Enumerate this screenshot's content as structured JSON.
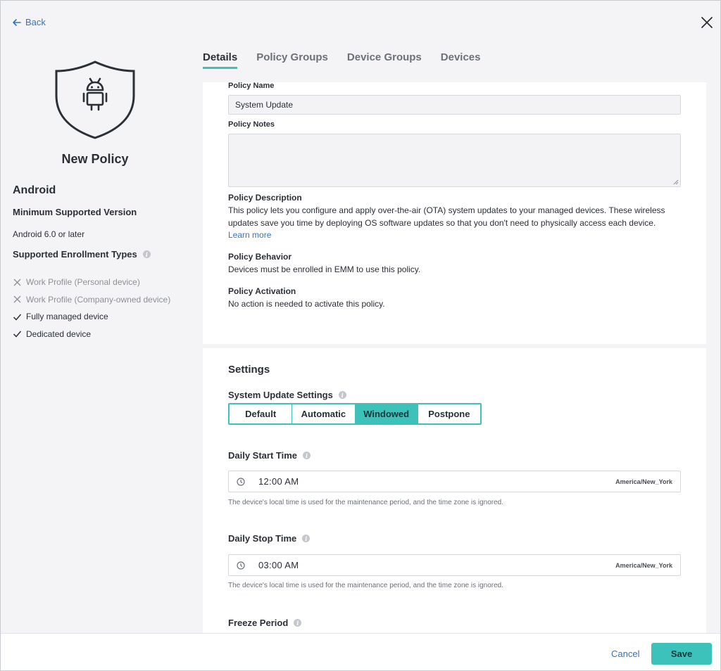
{
  "header": {
    "back_label": "Back"
  },
  "sidebar": {
    "policy_title": "New Policy",
    "os_title": "Android",
    "min_version_title": "Minimum Supported Version",
    "min_version_value": "Android 6.0 or later",
    "enrollment_title": "Supported Enrollment Types",
    "enrollment_types": [
      {
        "label": "Work Profile (Personal device)",
        "supported": false
      },
      {
        "label": "Work Profile (Company-owned device)",
        "supported": false
      },
      {
        "label": "Fully managed device",
        "supported": true
      },
      {
        "label": "Dedicated device",
        "supported": true
      }
    ]
  },
  "tabs": [
    {
      "label": "Details",
      "active": true
    },
    {
      "label": "Policy Groups",
      "active": false
    },
    {
      "label": "Device Groups",
      "active": false
    },
    {
      "label": "Devices",
      "active": false
    }
  ],
  "details": {
    "policy_name_label": "Policy Name",
    "policy_name_value": "System Update",
    "policy_notes_label": "Policy Notes",
    "policy_notes_value": "",
    "description_title": "Policy Description",
    "description_text": "This policy lets you configure and apply over-the-air (OTA) system updates to your managed devices. These wireless updates save you time by deploying OS software updates so that you don't need to physically access each device.",
    "learn_more": "Learn more",
    "behavior_title": "Policy Behavior",
    "behavior_text": "Devices must be enrolled in EMM to use this policy.",
    "activation_title": "Policy Activation",
    "activation_text": "No action is needed to activate this policy."
  },
  "settings": {
    "title": "Settings",
    "system_update_label": "System Update Settings",
    "options": [
      "Default",
      "Automatic",
      "Windowed",
      "Postpone"
    ],
    "selected_option": "Windowed",
    "daily_start_label": "Daily Start Time",
    "daily_start_value": "12:00  AM",
    "daily_start_tz": "America/New_York",
    "daily_stop_label": "Daily Stop Time",
    "daily_stop_value": "03:00  AM",
    "daily_stop_tz": "America/New_York",
    "time_hint": "The device's local time is used for the maintenance period, and the time zone is ignored.",
    "freeze_label": "Freeze Period"
  },
  "footer": {
    "cancel_label": "Cancel",
    "save_label": "Save"
  },
  "colors": {
    "accent": "#3cc2ba",
    "link": "#3a73b5",
    "background": "#f4f4f7",
    "text": "#2b2f36"
  },
  "icons": [
    "arrow-left-icon",
    "close-icon",
    "android-shield-icon",
    "info-icon",
    "x-icon",
    "check-icon",
    "clock-icon"
  ]
}
